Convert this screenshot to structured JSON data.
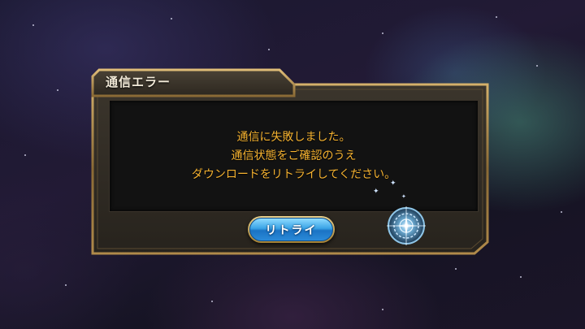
{
  "dialog": {
    "title": "通信エラー",
    "message_lines": [
      "通信に失敗しました。",
      "通信状態をご確認のうえ",
      "ダウンロードをリトライしてください。"
    ],
    "retry_label": "リトライ"
  },
  "icons": {
    "loading": "compass-emblem-icon",
    "sparkle": "sparkle-icon"
  },
  "colors": {
    "message_text": "#f5b230",
    "frame_gold": "#b08a4a",
    "button_blue": "#2a8ad8"
  }
}
